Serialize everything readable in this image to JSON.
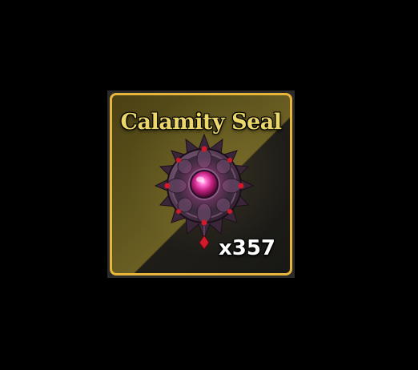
{
  "item": {
    "name": "Calamity Seal",
    "quantity": "x357",
    "icon": "calamity-seal-icon"
  },
  "colors": {
    "frame_border": "#e8b53a",
    "name_text": "#ecd76a",
    "quantity_text": "#ffffff",
    "gem_core": "#e0409a",
    "background": "#000000"
  }
}
